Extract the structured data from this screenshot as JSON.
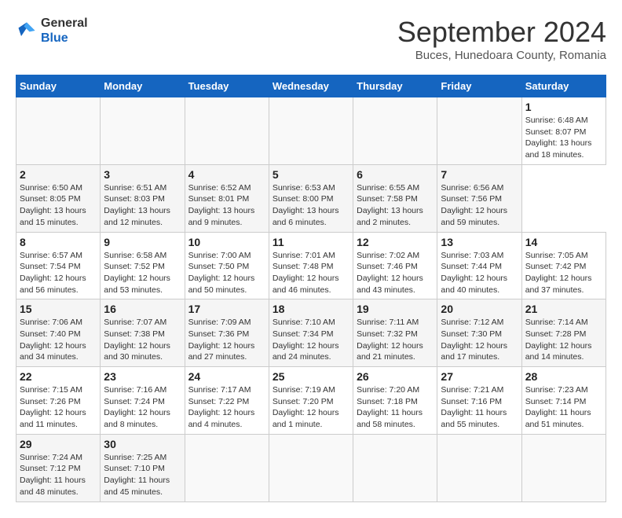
{
  "header": {
    "logo": {
      "general": "General",
      "blue": "Blue"
    },
    "title": "September 2024",
    "subtitle": "Buces, Hunedoara County, Romania"
  },
  "calendar": {
    "days_of_week": [
      "Sunday",
      "Monday",
      "Tuesday",
      "Wednesday",
      "Thursday",
      "Friday",
      "Saturday"
    ],
    "weeks": [
      [
        {
          "day": "",
          "info": ""
        },
        {
          "day": "",
          "info": ""
        },
        {
          "day": "",
          "info": ""
        },
        {
          "day": "",
          "info": ""
        },
        {
          "day": "",
          "info": ""
        },
        {
          "day": "",
          "info": ""
        },
        {
          "day": "1",
          "info": "Sunrise: 6:48 AM\nSunset: 8:07 PM\nDaylight: 13 hours and 18 minutes."
        }
      ],
      [
        {
          "day": "2",
          "info": "Sunrise: 6:50 AM\nSunset: 8:05 PM\nDaylight: 13 hours and 15 minutes."
        },
        {
          "day": "3",
          "info": "Sunrise: 6:51 AM\nSunset: 8:03 PM\nDaylight: 13 hours and 12 minutes."
        },
        {
          "day": "4",
          "info": "Sunrise: 6:52 AM\nSunset: 8:01 PM\nDaylight: 13 hours and 9 minutes."
        },
        {
          "day": "5",
          "info": "Sunrise: 6:53 AM\nSunset: 8:00 PM\nDaylight: 13 hours and 6 minutes."
        },
        {
          "day": "6",
          "info": "Sunrise: 6:55 AM\nSunset: 7:58 PM\nDaylight: 13 hours and 2 minutes."
        },
        {
          "day": "7",
          "info": "Sunrise: 6:56 AM\nSunset: 7:56 PM\nDaylight: 12 hours and 59 minutes."
        }
      ],
      [
        {
          "day": "8",
          "info": "Sunrise: 6:57 AM\nSunset: 7:54 PM\nDaylight: 12 hours and 56 minutes."
        },
        {
          "day": "9",
          "info": "Sunrise: 6:58 AM\nSunset: 7:52 PM\nDaylight: 12 hours and 53 minutes."
        },
        {
          "day": "10",
          "info": "Sunrise: 7:00 AM\nSunset: 7:50 PM\nDaylight: 12 hours and 50 minutes."
        },
        {
          "day": "11",
          "info": "Sunrise: 7:01 AM\nSunset: 7:48 PM\nDaylight: 12 hours and 46 minutes."
        },
        {
          "day": "12",
          "info": "Sunrise: 7:02 AM\nSunset: 7:46 PM\nDaylight: 12 hours and 43 minutes."
        },
        {
          "day": "13",
          "info": "Sunrise: 7:03 AM\nSunset: 7:44 PM\nDaylight: 12 hours and 40 minutes."
        },
        {
          "day": "14",
          "info": "Sunrise: 7:05 AM\nSunset: 7:42 PM\nDaylight: 12 hours and 37 minutes."
        }
      ],
      [
        {
          "day": "15",
          "info": "Sunrise: 7:06 AM\nSunset: 7:40 PM\nDaylight: 12 hours and 34 minutes."
        },
        {
          "day": "16",
          "info": "Sunrise: 7:07 AM\nSunset: 7:38 PM\nDaylight: 12 hours and 30 minutes."
        },
        {
          "day": "17",
          "info": "Sunrise: 7:09 AM\nSunset: 7:36 PM\nDaylight: 12 hours and 27 minutes."
        },
        {
          "day": "18",
          "info": "Sunrise: 7:10 AM\nSunset: 7:34 PM\nDaylight: 12 hours and 24 minutes."
        },
        {
          "day": "19",
          "info": "Sunrise: 7:11 AM\nSunset: 7:32 PM\nDaylight: 12 hours and 21 minutes."
        },
        {
          "day": "20",
          "info": "Sunrise: 7:12 AM\nSunset: 7:30 PM\nDaylight: 12 hours and 17 minutes."
        },
        {
          "day": "21",
          "info": "Sunrise: 7:14 AM\nSunset: 7:28 PM\nDaylight: 12 hours and 14 minutes."
        }
      ],
      [
        {
          "day": "22",
          "info": "Sunrise: 7:15 AM\nSunset: 7:26 PM\nDaylight: 12 hours and 11 minutes."
        },
        {
          "day": "23",
          "info": "Sunrise: 7:16 AM\nSunset: 7:24 PM\nDaylight: 12 hours and 8 minutes."
        },
        {
          "day": "24",
          "info": "Sunrise: 7:17 AM\nSunset: 7:22 PM\nDaylight: 12 hours and 4 minutes."
        },
        {
          "day": "25",
          "info": "Sunrise: 7:19 AM\nSunset: 7:20 PM\nDaylight: 12 hours and 1 minute."
        },
        {
          "day": "26",
          "info": "Sunrise: 7:20 AM\nSunset: 7:18 PM\nDaylight: 11 hours and 58 minutes."
        },
        {
          "day": "27",
          "info": "Sunrise: 7:21 AM\nSunset: 7:16 PM\nDaylight: 11 hours and 55 minutes."
        },
        {
          "day": "28",
          "info": "Sunrise: 7:23 AM\nSunset: 7:14 PM\nDaylight: 11 hours and 51 minutes."
        }
      ],
      [
        {
          "day": "29",
          "info": "Sunrise: 7:24 AM\nSunset: 7:12 PM\nDaylight: 11 hours and 48 minutes."
        },
        {
          "day": "30",
          "info": "Sunrise: 7:25 AM\nSunset: 7:10 PM\nDaylight: 11 hours and 45 minutes."
        },
        {
          "day": "",
          "info": ""
        },
        {
          "day": "",
          "info": ""
        },
        {
          "day": "",
          "info": ""
        },
        {
          "day": "",
          "info": ""
        },
        {
          "day": "",
          "info": ""
        }
      ]
    ]
  }
}
